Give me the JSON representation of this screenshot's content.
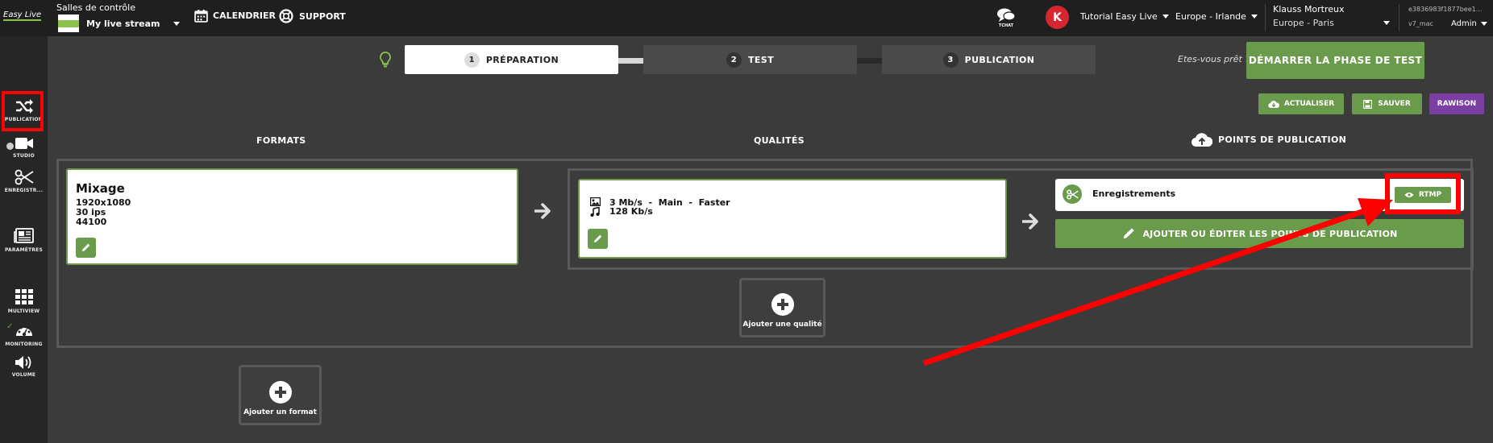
{
  "app": {
    "logo_text": "Easy Live"
  },
  "topbar": {
    "control_room_label": "Salles de contrôle",
    "stream_name": "My live stream",
    "nav": [
      {
        "label": "CALENDRIER",
        "icon": "calendar-icon"
      },
      {
        "label": "SUPPORT",
        "icon": "lifebuoy-icon"
      }
    ],
    "chat_label": "TCHAT",
    "avatar_letter": "K",
    "workspace": "Tutorial Easy Live",
    "region": "Europe - Irlande",
    "user_name": "Klauss Mortreux",
    "timezone": "Europe - Paris",
    "session_id": "e3836983f1877bee1...",
    "version": "v7_mac",
    "role": "Admin"
  },
  "steps": [
    {
      "num": "1",
      "label": "PRÉPARATION",
      "active": true
    },
    {
      "num": "2",
      "label": "TEST",
      "active": false
    },
    {
      "num": "3",
      "label": "PUBLICATION",
      "active": false
    }
  ],
  "ready_text": "Etes-vous prêt ?",
  "start_test_button": "DÉMARRER LA PHASE DE TEST",
  "actions": {
    "refresh": "ACTUALISER",
    "save": "SAUVER",
    "rawison": "RAWISON"
  },
  "sidebar": [
    {
      "label": "PUBLICATION",
      "icon": "shuffle-icon",
      "highlighted": true
    },
    {
      "label": "STUDIO",
      "icon": "video-camera-icon"
    },
    {
      "label": "ENREGISTR...",
      "icon": "scissors-icon"
    },
    {
      "label": "PARAMÈTRES",
      "icon": "newspaper-icon"
    },
    {
      "label": "MULTIVIEW",
      "icon": "grid-icon"
    },
    {
      "label": "MONITORING",
      "icon": "dashboard-icon"
    },
    {
      "label": "VOLUME",
      "icon": "volume-icon"
    }
  ],
  "columns": {
    "formats": "FORMATS",
    "qualities": "QUALITÉS",
    "publication_points": "POINTS DE PUBLICATION"
  },
  "format": {
    "name": "Mixage",
    "resolution": "1920x1080",
    "fps": "30 ips",
    "sample_rate": "44100"
  },
  "quality": {
    "video": "3 Mb/s  -  Main  -  Faster",
    "audio": "128 Kb/s"
  },
  "publication_point": {
    "name": "Enregistrements",
    "rtmp_label": "RTMP",
    "add_edit_label": "AJOUTER OU ÉDITER LES POINTS DE PUBLICATION"
  },
  "add_quality": "Ajouter une qualité",
  "add_format": "Ajouter un format",
  "colors": {
    "accent_green": "#6a9a4c",
    "highlight_red": "#ff0000",
    "purple": "#7b3fa3",
    "avatar_red": "#d6262f"
  }
}
